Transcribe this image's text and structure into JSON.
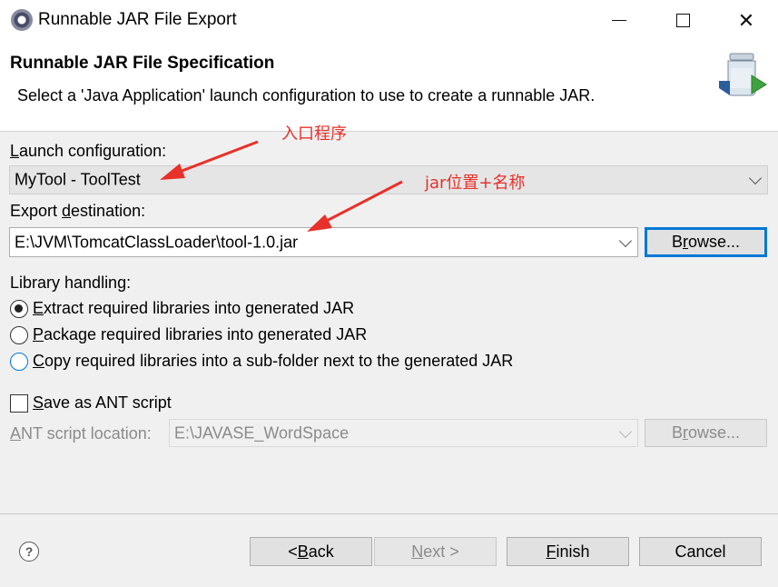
{
  "window": {
    "title": "Runnable JAR File Export",
    "minimize_icon": "minimize-icon",
    "maximize_icon": "maximize-icon",
    "close_symbol": "✕"
  },
  "banner": {
    "title": "Runnable JAR File Specification",
    "description": "Select a 'Java Application' launch configuration to use to create a runnable JAR.",
    "icon": "jar-export-icon"
  },
  "launch": {
    "label_mnemonic": "L",
    "label_rest": "aunch configuration:",
    "value": "MyTool - ToolTest"
  },
  "export": {
    "label_pre": "Export ",
    "label_mnemonic": "d",
    "label_rest": "estination:",
    "value": "E:\\JVM\\TomcatClassLoader\\tool-1.0.jar",
    "browse_mnemonic": "r",
    "browse_pre": "B",
    "browse_rest": "owse..."
  },
  "library": {
    "label": "Library handling:",
    "options": [
      {
        "mnemonic": "E",
        "rest": "xtract required libraries into generated JAR",
        "checked": true
      },
      {
        "mnemonic": "P",
        "rest": "ackage required libraries into generated JAR",
        "checked": false
      },
      {
        "mnemonic": "C",
        "rest": "opy required libraries into a sub-folder next to the generated JAR",
        "checked": false
      }
    ]
  },
  "ant": {
    "checkbox_mnemonic": "S",
    "checkbox_rest": "ave as ANT script",
    "checked": false,
    "location_mnemonic": "A",
    "location_rest": "NT script location:",
    "location_value": "E:\\JAVASE_WordSpace",
    "browse_pre": "B",
    "browse_mnemonic": "r",
    "browse_rest": "owse..."
  },
  "footer": {
    "help_symbol": "?",
    "back_pre": "< ",
    "back_mnemonic": "B",
    "back_rest": "ack",
    "next_mnemonic": "N",
    "next_rest": "ext >",
    "finish_mnemonic": "F",
    "finish_rest": "inish",
    "cancel_label": "Cancel"
  },
  "annotations": {
    "entry_program": "入口程序",
    "jar_location_name": "jar位置+名称",
    "color": "#e8312a"
  },
  "colors": {
    "focus_accent": "#0078d7",
    "window_bg": "#f0f0f0"
  }
}
